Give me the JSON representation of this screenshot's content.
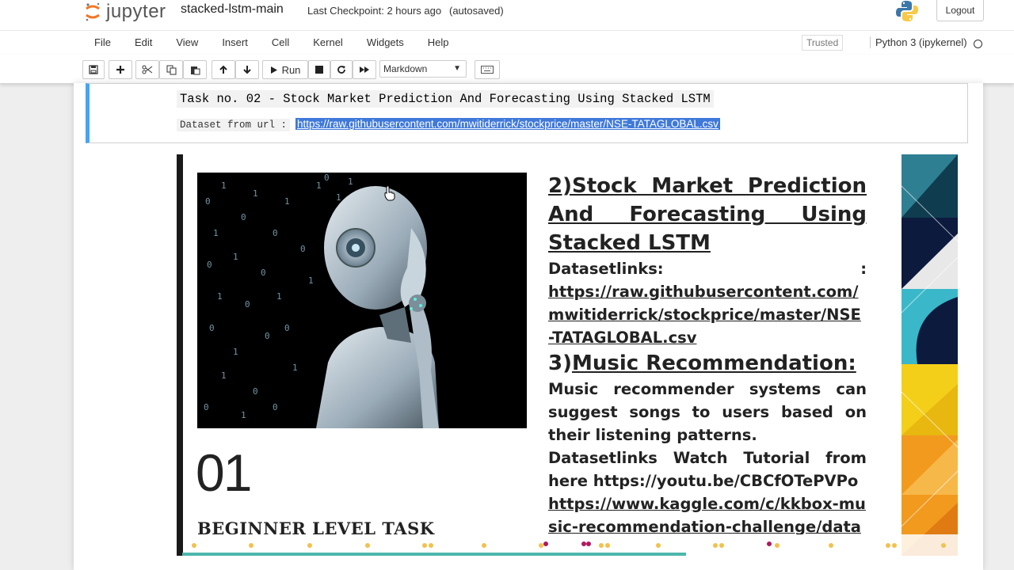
{
  "header": {
    "logo_text": "jupyter",
    "notebook_name": "stacked-lstm-main",
    "checkpoint": "Last Checkpoint: 2 hours ago",
    "autosave": "(autosaved)",
    "logout": "Logout"
  },
  "menu": {
    "items": [
      "File",
      "Edit",
      "View",
      "Insert",
      "Cell",
      "Kernel",
      "Widgets",
      "Help"
    ],
    "trusted": "Trusted",
    "kernel": "Python 3 (ipykernel)"
  },
  "toolbar": {
    "run_label": "Run",
    "cell_type": "Markdown",
    "icons": [
      "save-icon",
      "add-cell-icon",
      "cut-icon",
      "copy-icon",
      "paste-icon",
      "move-up-icon",
      "move-down-icon",
      "run-icon",
      "stop-icon",
      "restart-icon",
      "fast-forward-icon",
      "keyboard-icon"
    ]
  },
  "cell": {
    "task_title": "Task no. 02 - Stock Market Prediction And Forecasting Using Stacked LSTM",
    "dataset_label": "Dataset from url :",
    "dataset_url": "https://raw.githubusercontent.com/mwitiderrick/stockprice/master/NSE-TATAGLOBAL.csv"
  },
  "slide": {
    "number": "01",
    "level": "BEGINNER LEVEL TASK",
    "heading1": "2)Stock Market Prediction And Forecasting Using Stacked LSTM",
    "datasetlinks_label": "Datasetlinks:",
    "datasetlinks_colon": ":",
    "stock_link": "https://raw.githubusercontent.com/ mwitiderrick/stockprice/master/NSE -TATAGLOBAL.csv",
    "heading2_prefix": "3)",
    "heading2": "Music Recommendation:",
    "music_desc": "Music recommender systems can suggest songs to users based on their listening patterns.",
    "music_links": "Datasetlinks Watch Tutorial from here https://youtu.be/CBCfOTePVPo",
    "kaggle_link": "https://www.kaggle.com/c/kkbox-music-recommendation-challenge/data"
  },
  "colors": {
    "accent": "#42a5f5",
    "link_highlight": "#3f79d9",
    "progress": "#4db6ac"
  }
}
